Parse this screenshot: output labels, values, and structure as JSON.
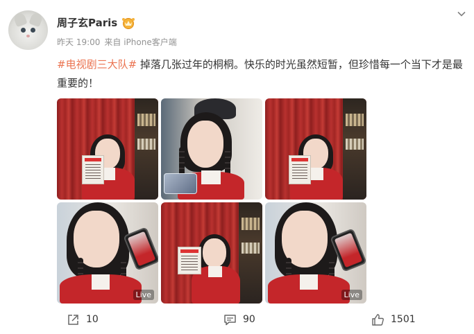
{
  "author": {
    "name": "周子玄Paris",
    "avatar_icon": "cat-avatar",
    "badge_icon": "vip-crown-icon"
  },
  "post": {
    "time": "昨天 19:00",
    "source": "来自 iPhone客户端",
    "hashtag": "#电视剧三大队#",
    "text": " 掉落几张过年的桐桐。快乐的时光虽然短暂，但珍惜每一个当下才是最重要的！"
  },
  "images": [
    {
      "live": false
    },
    {
      "live": false
    },
    {
      "live": false
    },
    {
      "live": true,
      "live_label": "Live"
    },
    {
      "live": false
    },
    {
      "live": true,
      "live_label": "Live"
    }
  ],
  "actions": {
    "repost_count": "10",
    "comment_count": "90",
    "like_count": "1501"
  },
  "colors": {
    "hashtag": "#eb7350",
    "meta": "#939393",
    "text": "#333333"
  }
}
